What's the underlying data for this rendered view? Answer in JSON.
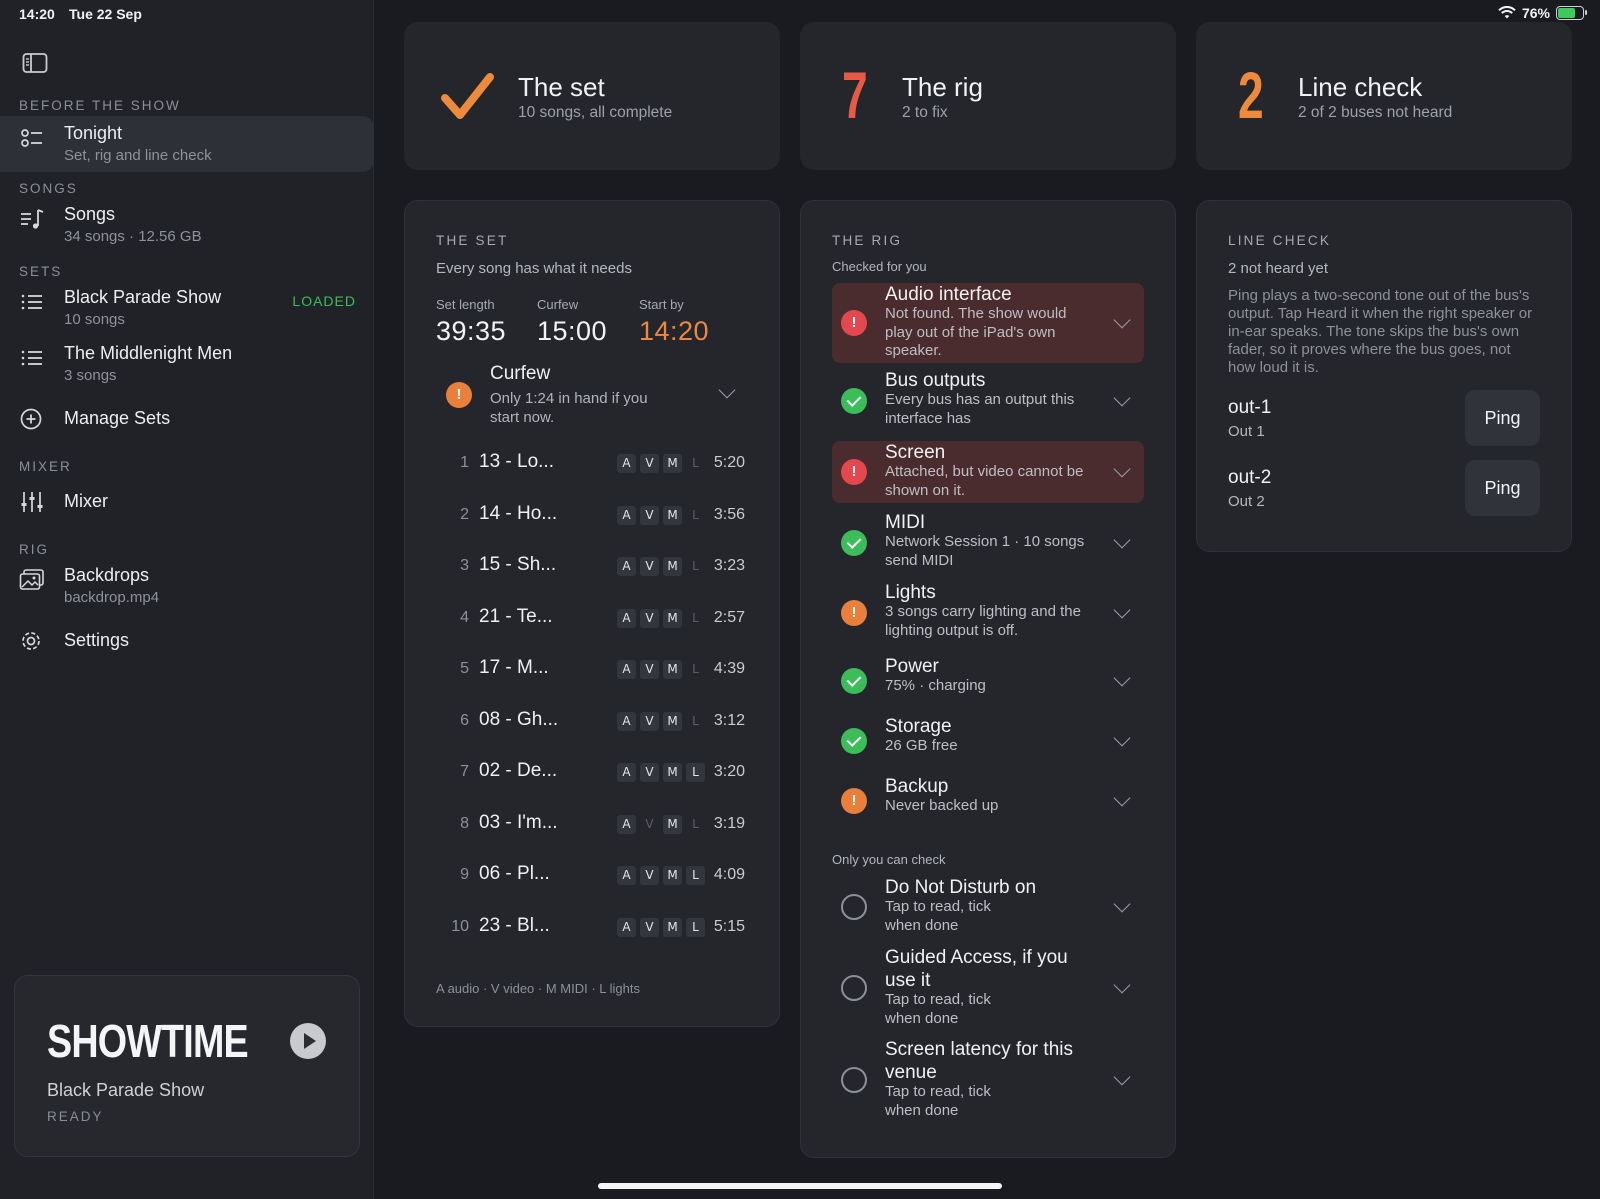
{
  "status_bar": {
    "time": "14:20",
    "date": "Tue 22 Sep",
    "battery": "76%",
    "battery_level": 0.76
  },
  "sidebar": {
    "sections": {
      "before_show": "BEFORE THE SHOW",
      "songs": "SONGS",
      "sets": "SETS",
      "mixer": "MIXER",
      "rig": "RIG"
    },
    "tonight": {
      "title": "Tonight",
      "sub": "Set, rig and line check"
    },
    "songs": {
      "title": "Songs",
      "sub": "34 songs · 12.56 GB"
    },
    "sets": [
      {
        "title": "Black Parade Show",
        "sub": "10 songs",
        "badge": "LOADED"
      },
      {
        "title": "The Middlenight Men",
        "sub": "3 songs"
      }
    ],
    "manage_sets": "Manage Sets",
    "mixer": "Mixer",
    "backdrops": {
      "title": "Backdrops",
      "sub": "backdrop.mp4"
    },
    "settings": "Settings",
    "showtime": {
      "title": "SHOWTIME",
      "set_name": "Black Parade Show",
      "state": "READY"
    }
  },
  "summary": [
    {
      "number": "",
      "title": "The set",
      "sub": "10 songs, all complete",
      "color": "#ee8a3c"
    },
    {
      "number": "7",
      "title": "The rig",
      "sub": "2 to fix",
      "color": "#e85a45"
    },
    {
      "number": "2",
      "title": "Line check",
      "sub": "2 of 2 buses not heard",
      "color": "#ee8a3c"
    }
  ],
  "set_panel": {
    "title": "THE SET",
    "subtitle": "Every song has what it needs",
    "stats": [
      {
        "label": "Set length",
        "value": "39:35"
      },
      {
        "label": "Curfew",
        "value": "15:00"
      },
      {
        "label": "Start by",
        "value": "14:20"
      }
    ],
    "curfew_warning": {
      "title": "Curfew",
      "sub": "Only 1:24 in hand if you start now."
    },
    "songs": [
      {
        "num": "1",
        "title": "13 - Lo...",
        "a": true,
        "v": true,
        "m": true,
        "l": false,
        "dur": "5:20"
      },
      {
        "num": "2",
        "title": "14 - Ho...",
        "a": true,
        "v": true,
        "m": true,
        "l": false,
        "dur": "3:56"
      },
      {
        "num": "3",
        "title": "15 - Sh...",
        "a": true,
        "v": true,
        "m": true,
        "l": false,
        "dur": "3:23"
      },
      {
        "num": "4",
        "title": "21 - Te...",
        "a": true,
        "v": true,
        "m": true,
        "l": false,
        "dur": "2:57"
      },
      {
        "num": "5",
        "title": "17 - M...",
        "a": true,
        "v": true,
        "m": true,
        "l": false,
        "dur": "4:39"
      },
      {
        "num": "6",
        "title": "08 - Gh...",
        "a": true,
        "v": true,
        "m": true,
        "l": false,
        "dur": "3:12"
      },
      {
        "num": "7",
        "title": "02 - De...",
        "a": true,
        "v": true,
        "m": true,
        "l": true,
        "dur": "3:20"
      },
      {
        "num": "8",
        "title": "03 - I'm...",
        "a": true,
        "v": false,
        "m": true,
        "l": false,
        "dur": "3:19"
      },
      {
        "num": "9",
        "title": "06 - Pl...",
        "a": true,
        "v": true,
        "m": true,
        "l": true,
        "dur": "4:09"
      },
      {
        "num": "10",
        "title": "23 - Bl...",
        "a": true,
        "v": true,
        "m": true,
        "l": true,
        "dur": "5:15"
      }
    ],
    "badge_letters": [
      "A",
      "V",
      "M",
      "L"
    ],
    "legend": "A audio · V video · M MIDI · L lights"
  },
  "rig_panel": {
    "title": "THE RIG",
    "checked_label": "Checked for you",
    "manual_label": "Only you can check",
    "items": [
      {
        "title": "Audio interface",
        "sub": "Not found. The show would play out of the iPad's own speaker.",
        "status": "error"
      },
      {
        "title": "Bus outputs",
        "sub": "Every bus has an output this interface has",
        "status": "ok"
      },
      {
        "title": "Screen",
        "sub": "Attached, but video cannot be shown on it.",
        "status": "error"
      },
      {
        "title": "MIDI",
        "sub": "Network Session 1 · 10 songs send MIDI",
        "status": "ok"
      },
      {
        "title": "Lights",
        "sub": "3 songs carry lighting and the lighting output is off.",
        "status": "warn"
      },
      {
        "title": "Power",
        "sub": "75% · charging",
        "status": "ok"
      },
      {
        "title": "Storage",
        "sub": "26 GB free",
        "status": "ok"
      },
      {
        "title": "Backup",
        "sub": "Never backed up",
        "status": "warn"
      }
    ],
    "manual_items": [
      {
        "title": "Do Not Disturb on",
        "sub": "Tap to read, tick when done"
      },
      {
        "title": "Guided Access, if you use it",
        "sub": "Tap to read, tick when done"
      },
      {
        "title": "Screen latency for this venue",
        "sub": "Tap to read, tick when done"
      }
    ]
  },
  "line_check_panel": {
    "title": "LINE CHECK",
    "subtitle": "2 not heard yet",
    "description": "Ping plays a two-second tone out of the bus's output. Tap Heard it when the right speaker or in-ear speaks. The tone skips the bus's own fader, so it proves where the bus goes, not how loud it is.",
    "buses": [
      {
        "name": "out-1",
        "sub": "Out 1",
        "button": "Ping"
      },
      {
        "name": "out-2",
        "sub": "Out 2",
        "button": "Ping"
      }
    ]
  },
  "colors": {
    "accent_orange": "#ec8844",
    "error_red": "#e2484e",
    "ok_green": "#3cbd5a"
  }
}
